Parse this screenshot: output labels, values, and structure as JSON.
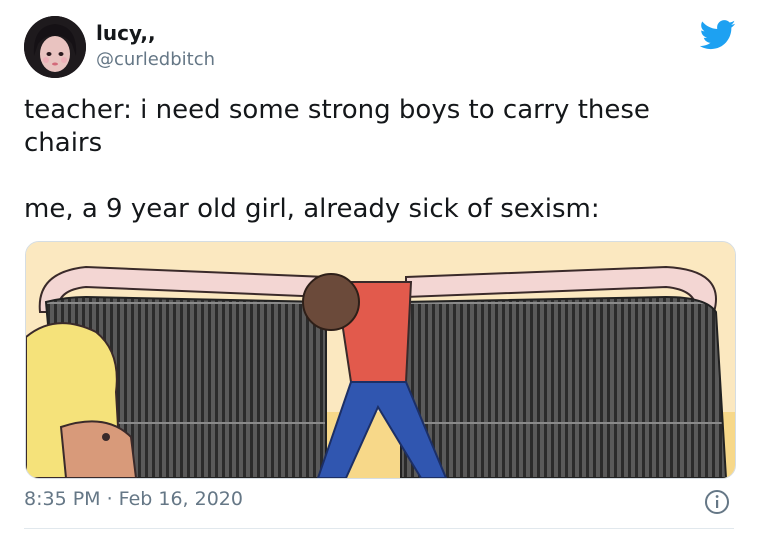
{
  "author": {
    "display_name": "lucy,,",
    "handle": "@curledbitch"
  },
  "tweet": {
    "line1": "teacher: i need some strong boys to carry these chairs",
    "line2": "me, a 9 year old girl, already sick of sexism:",
    "timestamp": "8:35 PM · Feb 16, 2020"
  },
  "icons": {
    "platform": "twitter-bird-icon",
    "info": "info-icon"
  },
  "colors": {
    "brand_blue": "#1da1f2",
    "secondary_text": "#657786",
    "primary_text": "#14171a"
  }
}
